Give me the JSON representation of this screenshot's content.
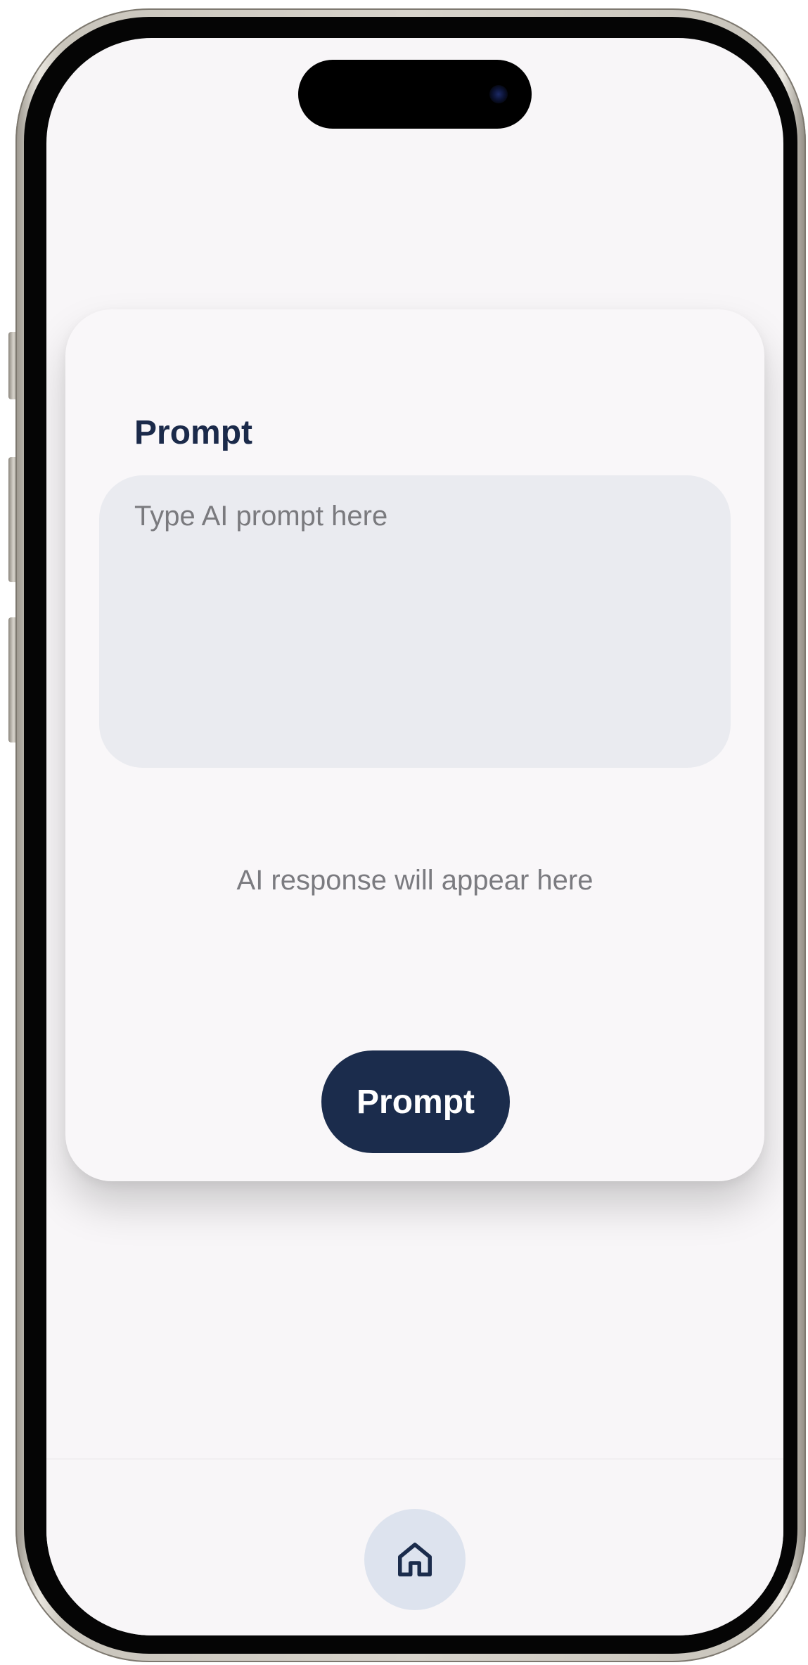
{
  "card": {
    "title": "Prompt",
    "input_placeholder": "Type AI prompt here",
    "input_value": "",
    "response_text": "AI response will appear here",
    "submit_label": "Prompt"
  },
  "bottom_nav": {
    "items": [
      {
        "icon": "home-icon",
        "active": true
      }
    ]
  },
  "colors": {
    "accent": "#1b2c4c",
    "title": "#1b2a4a",
    "input_background": "#eaebf0",
    "screen_background": "#f8f6f8",
    "home_button_background": "#dde3ee"
  }
}
